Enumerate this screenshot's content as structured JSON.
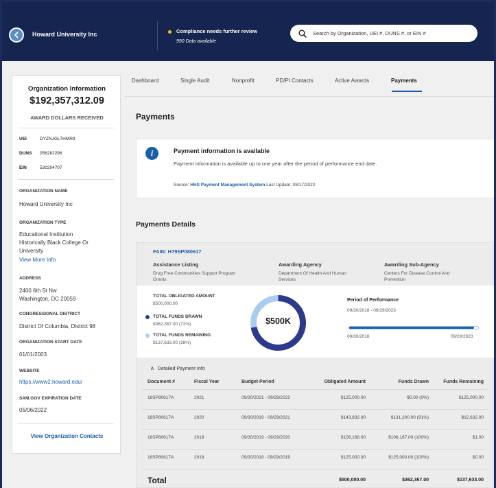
{
  "header": {
    "org_name": "Howard University Inc",
    "compliance": "Compliance needs further review",
    "data_available": "990 Data available",
    "search_placeholder": "Search by Organization, UEI #, DUNS #, or EIN #",
    "compliance_dot_color": "#f5c518"
  },
  "sidebar": {
    "title": "Organization Information",
    "amount": "$192,357,312.09",
    "amount_label": "AWARD DOLLARS RECEIVED",
    "ids": [
      {
        "key": "UEI",
        "value": "DYZNJGLTHMR9"
      },
      {
        "key": "DUNS",
        "value": "056282296"
      },
      {
        "key": "EIN",
        "value": "530204707"
      }
    ],
    "org_name_label": "ORGANIZATION NAME",
    "org_name": "Howard University Inc",
    "org_type_label": "ORGANIZATION TYPE",
    "org_type_1": "Educational Institution",
    "org_type_2": "Historically Black College Or",
    "org_type_3": "University",
    "view_more": "View More Info",
    "address_label": "ADDRESS",
    "address_1": "2400 6th St Nw",
    "address_2": "Washington, DC 20059",
    "district_label": "CONGRESSIONAL DISTRICT",
    "district": "District Of Columbia, District 98",
    "start_label": "ORGANIZATION START DATE",
    "start_date": "01/01/2003",
    "website_label": "WEBSITE",
    "website": "https://www2.howard.edu/",
    "sam_label": "SAM.GOV EXPIRATION DATE",
    "sam_date": "05/06/2022",
    "contacts": "View Organization Contacts"
  },
  "tabs": [
    "Dashboard",
    "Single Audit",
    "Nonprofit",
    "PD/PI Contacts",
    "Active Awards",
    "Payments"
  ],
  "active_tab": "Payments",
  "page_title": "Payments",
  "info": {
    "title": "Payment information is available",
    "text": "Payment information is available up to one year after the period of performance end date.",
    "source_prefix": "Source:",
    "source_link": "HHS Payment Management System",
    "last_update": "Last Update: 08/17/2022"
  },
  "details_title": "Payments Details",
  "award": {
    "fain": "FAIN: H79SP080617",
    "listing_label": "Assistance Listing",
    "listing_1": "Drug Free Communities Support Program",
    "listing_2": "Grants",
    "agency_label": "Awarding Agency",
    "agency_1": "Department Of Health And Human",
    "agency_2": "Services",
    "subagency_label": "Awarding Sub-Agency",
    "subagency_1": "Centers For Disease Control And",
    "subagency_2": "Prevention",
    "obligated_label": "TOTAL OBLIGATED AMOUNT",
    "obligated": "$500,000.00",
    "drawn_label": "TOTAL FUNDS DRAWN",
    "drawn": "$362,367.00 (72%)",
    "remaining_label": "TOTAL FUNDS REMAINING",
    "remaining": "$137,633.00 (28%)",
    "donut_center": "$500K",
    "drawn_fraction": 0.72,
    "drawn_color": "#2d3a8c",
    "remaining_color": "#a9cdf0",
    "pop_title": "Period of Performance",
    "pop_range": "09/30/2018 - 09/29/2023",
    "pop_start": "09/30/2018",
    "pop_end": "09/29/2023",
    "pop_progress": 0.97
  },
  "table": {
    "toggle": "Detailed Payment Info",
    "headers": [
      "Document #",
      "Fiscal Year",
      "Budget Period",
      "Obligated Amount",
      "Funds Drawn",
      "Funds Remaining"
    ],
    "rows": [
      [
        "18SP80617A",
        "2021",
        "09/30/2021 - 09/29/2022",
        "$125,000.00",
        "$0.00 (0%)",
        "$125,000.00"
      ],
      [
        "18SP80617A",
        "2020",
        "09/30/2019 - 09/29/2021",
        "$143,832.00",
        "$131,200.00 (91%)",
        "$12,632.00"
      ],
      [
        "18SP80617A",
        "2019",
        "09/30/2019 - 09/29/2020",
        "$106,168.00",
        "$106,167.00 (100%)",
        "$1.00"
      ],
      [
        "18SP80617A",
        "2018",
        "09/30/2018 - 09/29/2019",
        "$125,000.00",
        "$125,000.00 (100%)",
        "$0.00"
      ]
    ],
    "total_label": "Total",
    "totals": [
      "$500,000.00",
      "$362,367.00",
      "$137,633.00"
    ]
  }
}
